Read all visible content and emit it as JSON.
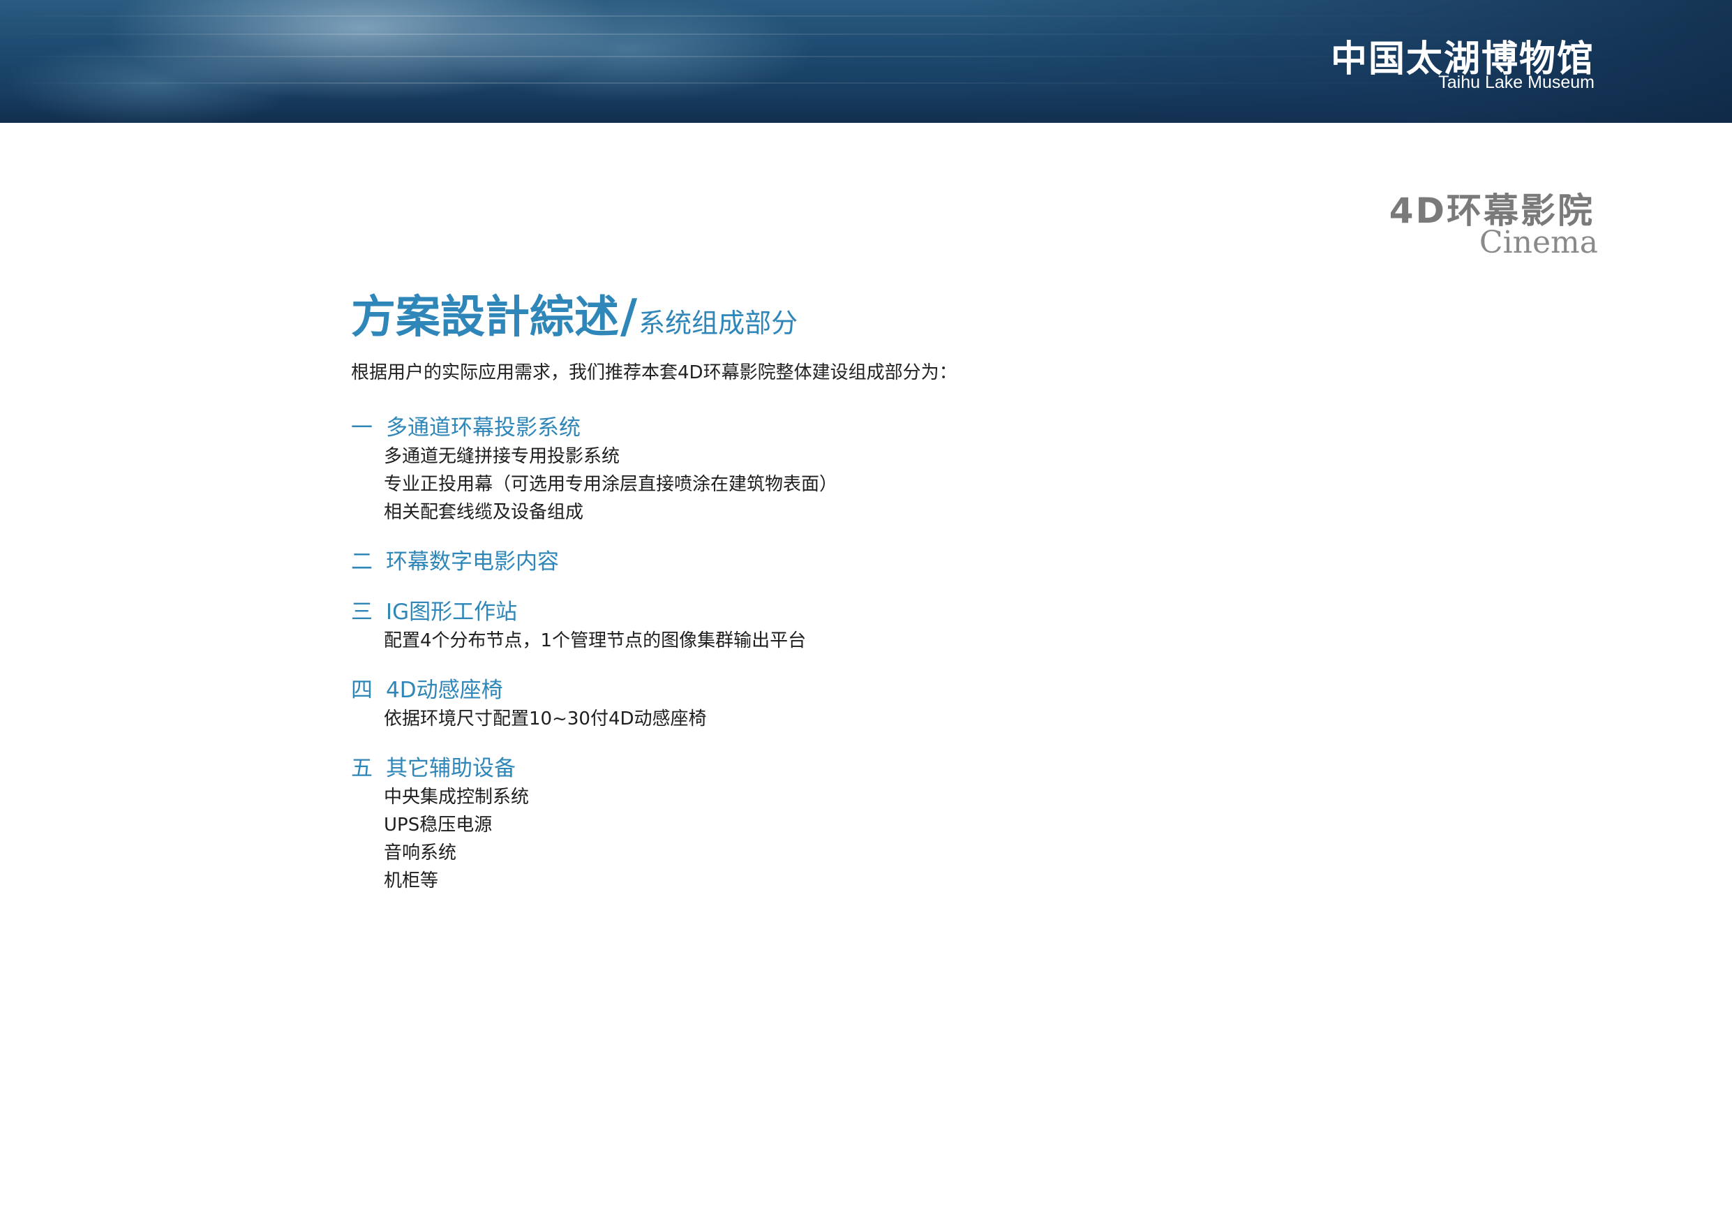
{
  "header": {
    "museum_cn": "中国太湖博物馆",
    "museum_en": "Taihu Lake Museum"
  },
  "section": {
    "title_cn": "4D环幕影院",
    "title_en": "Cinema"
  },
  "heading": {
    "main": "方案設計綜述",
    "slash": "/",
    "sub": "系统组成部分"
  },
  "intro": "根据用户的实际应用需求，我们推荐本套4D环幕影院整体建设组成部分为：",
  "groups": [
    {
      "num": "一",
      "title": "多通道环幕投影系统",
      "items": [
        "多通道无缝拼接专用投影系统",
        "专业正投用幕（可选用专用涂层直接喷涂在建筑物表面）",
        "相关配套线缆及设备组成"
      ]
    },
    {
      "num": "二",
      "title": "环幕数字电影内容",
      "items": []
    },
    {
      "num": "三",
      "title": "IG图形工作站",
      "items": [
        "配置4个分布节点，1个管理节点的图像集群输出平台"
      ]
    },
    {
      "num": "四",
      "title": "4D动感座椅",
      "items": [
        "依据环境尺寸配置10~30付4D动感座椅"
      ]
    },
    {
      "num": "五",
      "title": "其它辅助设备",
      "items": [
        "中央集成控制系统",
        "UPS稳压电源",
        "音响系统",
        "机柜等"
      ]
    }
  ],
  "colors": {
    "accent": "#2f86b8",
    "banner_dark": "#183f63",
    "section_gray": "#7a7a7a"
  }
}
